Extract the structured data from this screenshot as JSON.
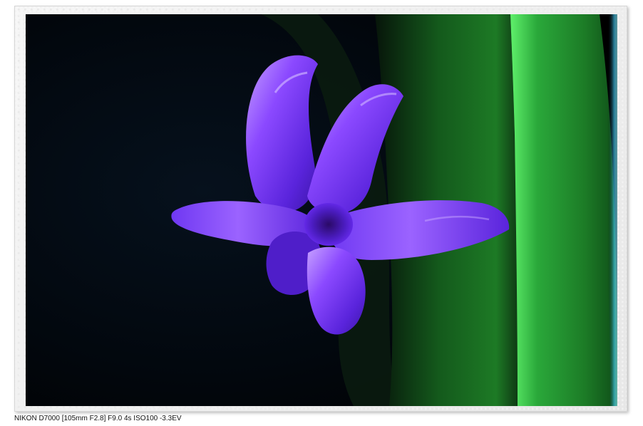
{
  "caption": {
    "exif_text": "NIKON D7000 [105mm F2.8] F9.0 4s ISO100 -3.3EV"
  },
  "photo": {
    "subject_icon": "hyacinth-flower-icon",
    "colors": {
      "background": "#000814",
      "petal": "#6a2cf2",
      "petal_highlight": "#b076ff",
      "leaf": "#1f8c2c",
      "leaf_highlight": "#44d24f"
    }
  }
}
